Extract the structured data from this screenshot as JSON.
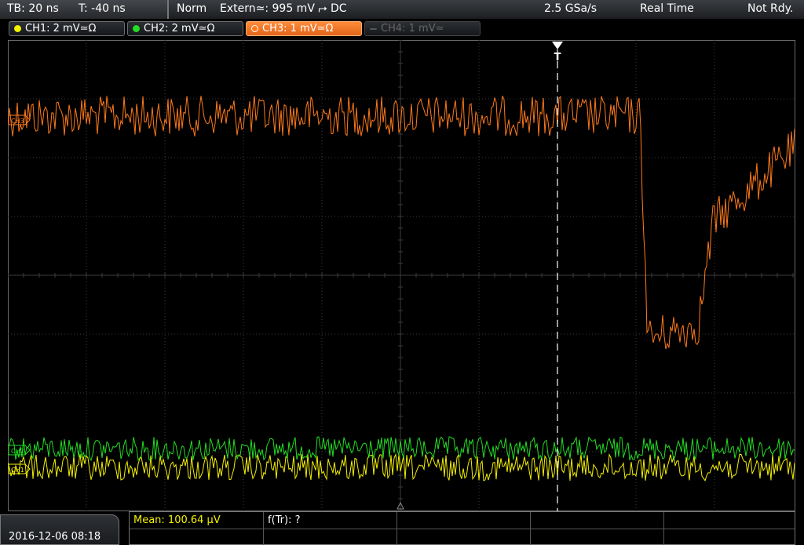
{
  "topbar": {
    "timebase": "TB: 20 ns",
    "trigger_time": "T: -40 ns",
    "mode": "Norm",
    "trigger_source": "Extern≃: 995 mV ⮣ DC",
    "sample_rate": "2.5 GSa/s",
    "acq_mode": "Real Time",
    "status": "Not Rdy."
  },
  "channels": [
    {
      "label": "CH1: 2 mV≃Ω",
      "color": "#f4f000",
      "state": "on"
    },
    {
      "label": "CH2: 2 mV≃Ω",
      "color": "#22dd22",
      "state": "on"
    },
    {
      "label": "CH3: 1 mV≃Ω",
      "color": "#ff7a1a",
      "state": "selected"
    },
    {
      "label": "CH4: 1 mV≃",
      "color": "#777777",
      "state": "off"
    }
  ],
  "markers": {
    "ch3": "CH3",
    "ch2": "CH2",
    "ch1": "CH1",
    "trigger": "T"
  },
  "measurements": {
    "mean": "Mean: 100.64 µV",
    "freq": "f(Tr): ?"
  },
  "datetime": "2016-12-06 08:18",
  "colors": {
    "ch1": "#f4f000",
    "ch2": "#22dd22",
    "ch3": "#ff7a1a",
    "grid": "#3c3c3c"
  }
}
